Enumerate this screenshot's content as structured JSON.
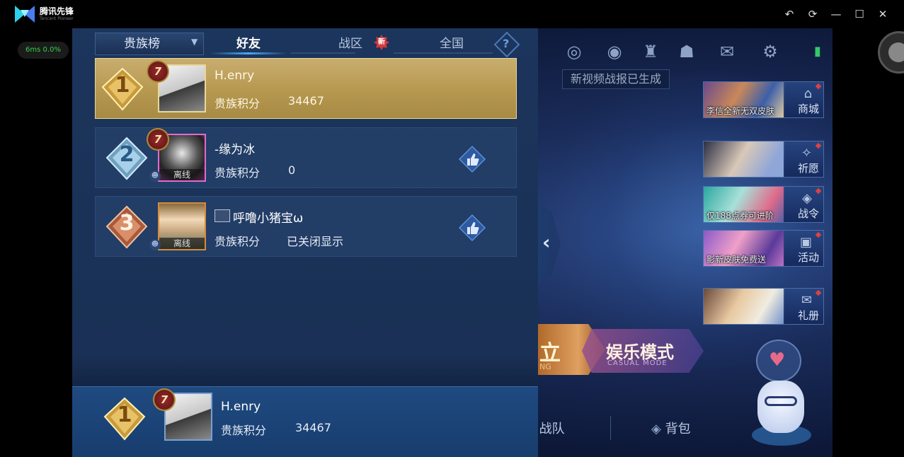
{
  "titlebar": {
    "brand": "腾讯先锋",
    "brand_sub": "Tencent Pioneer",
    "buttons": [
      "↶",
      "⟳",
      "—",
      "☐",
      "✕"
    ]
  },
  "status": {
    "ping": "6ms",
    "loss": "0.0%"
  },
  "leaderboard": {
    "selector_label": "贵族榜",
    "tabs": [
      {
        "label": "好友",
        "active": true
      },
      {
        "label": "战区",
        "active": false,
        "badge": "新"
      },
      {
        "label": "全国",
        "active": false
      }
    ],
    "help_symbol": "?",
    "rows": [
      {
        "rank": "1",
        "level": "7",
        "name": "H.enry",
        "score_label": "贵族积分",
        "score": "34467",
        "offline": "",
        "likeable": false
      },
      {
        "rank": "2",
        "level": "7",
        "name": "-缘为冰",
        "score_label": "贵族积分",
        "score": "0",
        "offline": "离线",
        "likeable": true
      },
      {
        "rank": "3",
        "level": "",
        "name": "呼噜小猪宝ω",
        "score_label": "贵族积分",
        "score": "已关闭显示",
        "offline": "离线",
        "likeable": true
      }
    ],
    "self": {
      "rank": "1",
      "level": "7",
      "name": "H.enry",
      "score_label": "贵族积分",
      "score": "34467"
    }
  },
  "game": {
    "notice": "新视频战报已生成",
    "banners": [
      {
        "caption": "李信全新无双皮肤",
        "side": "商城",
        "icon": "shop-icon"
      },
      {
        "caption": "",
        "side": "祈愿",
        "icon": "wish-icon"
      },
      {
        "caption": "仅188点券可进阶",
        "side": "战令",
        "icon": "pass-icon"
      },
      {
        "caption": "影新皮肤免费送",
        "side": "活动",
        "icon": "gift-icon"
      },
      {
        "caption": "",
        "side": "礼册",
        "icon": "book-icon"
      }
    ],
    "mode_ranked": "立",
    "mode_ranked_sub": "NG",
    "mode_casual": "娱乐模式",
    "mode_casual_sub": "CASUAL MODE",
    "nav_team": "战队",
    "nav_bag": "背包"
  },
  "colors": {
    "accent_blue": "#4aa8f0",
    "gold_row": "#b6984f",
    "panel": "#1c355c",
    "ping_green": "#34d34a"
  }
}
